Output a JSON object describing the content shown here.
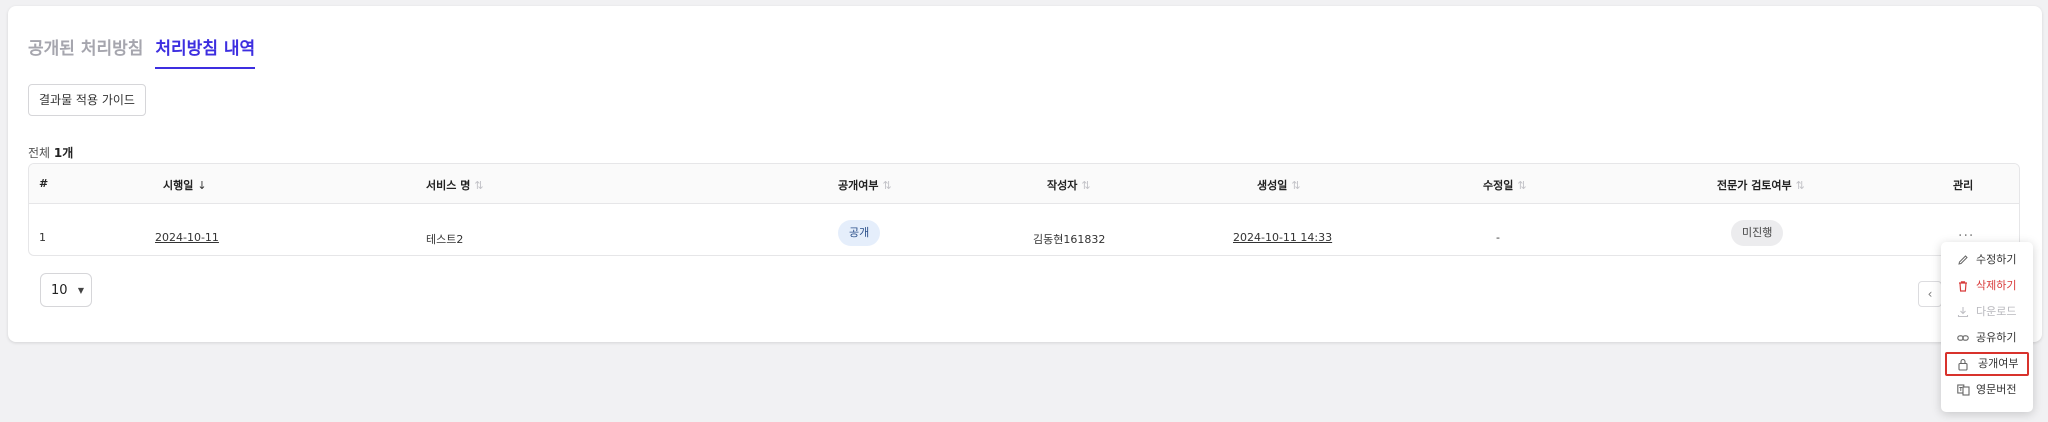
{
  "tabs": [
    {
      "label": "공개된 처리방침"
    },
    {
      "label": "처리방침 내역"
    }
  ],
  "guide_button": "결과물 적용 가이드",
  "total": {
    "prefix": "전체",
    "count": "1개"
  },
  "table": {
    "headers": [
      "#",
      "시행일",
      "서비스 명",
      "공개여부",
      "작성자",
      "생성일",
      "수정일",
      "전문가 검토여부",
      "관리"
    ],
    "row": {
      "index": "1",
      "effective_date": "2024-10-11",
      "service_name": "테스트2",
      "visibility": "공개",
      "author": "김동현161832",
      "created": "2024-10-11 14:33",
      "modified": "-",
      "expert_review": "미진행",
      "manage": "···"
    }
  },
  "pagination": {
    "page_size": "10",
    "prev": "‹"
  },
  "menu": {
    "items": [
      {
        "label": "수정하기",
        "icon": "pencil-icon"
      },
      {
        "label": "삭제하기",
        "icon": "trash-icon"
      },
      {
        "label": "다운로드",
        "icon": "download-icon"
      },
      {
        "label": "공유하기",
        "icon": "link-icon"
      },
      {
        "label": "공개여부",
        "icon": "lock-icon"
      },
      {
        "label": "영문버전",
        "icon": "translate-icon"
      }
    ]
  },
  "colors": {
    "accent": "#3d2ee0",
    "danger": "#d83a3a",
    "highlight": "#d8322c"
  }
}
